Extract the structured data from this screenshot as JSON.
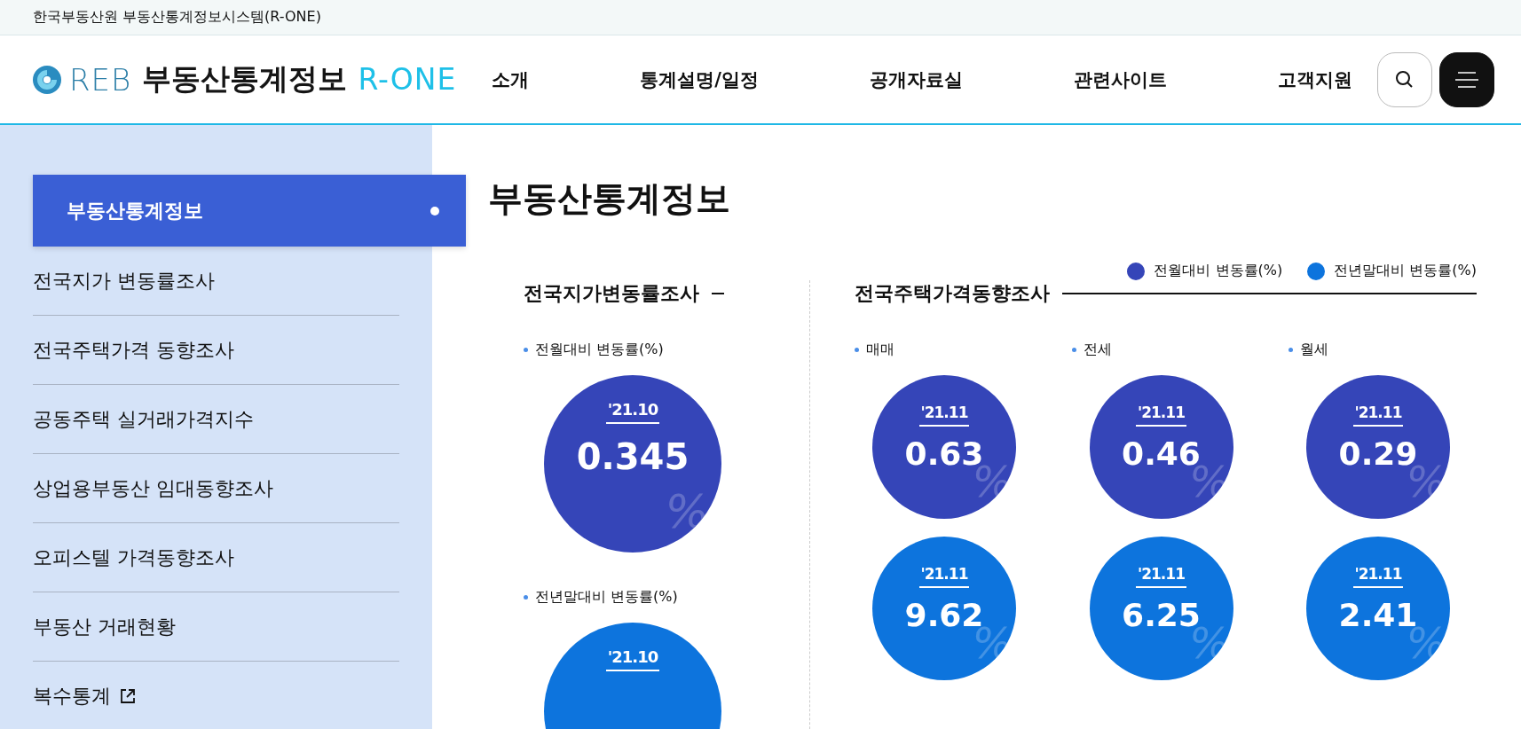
{
  "top_bar": {
    "text": "한국부동산원 부동산통계정보시스템(R-ONE)"
  },
  "header": {
    "logo": {
      "mark": "REB",
      "title": "부동산통계정보",
      "brand": "R-ONE"
    },
    "nav": [
      "소개",
      "통계설명/일정",
      "공개자료실",
      "관련사이트",
      "고객지원"
    ]
  },
  "sidebar": {
    "items": [
      {
        "label": "부동산통계정보",
        "selected": true,
        "external": false
      },
      {
        "label": "전국지가 변동률조사",
        "selected": false,
        "external": false
      },
      {
        "label": "전국주택가격 동향조사",
        "selected": false,
        "external": false
      },
      {
        "label": "공동주택 실거래가격지수",
        "selected": false,
        "external": false
      },
      {
        "label": "상업용부동산 임대동향조사",
        "selected": false,
        "external": false
      },
      {
        "label": "오피스텔 가격동향조사",
        "selected": false,
        "external": false
      },
      {
        "label": "부동산 거래현황",
        "selected": false,
        "external": false
      },
      {
        "label": "복수통계",
        "selected": false,
        "external": true
      }
    ]
  },
  "page_title": "부동산통계정보",
  "legend": [
    {
      "kind": "monthly",
      "label": "전월대비 변동률(%)",
      "color": "#3545b8"
    },
    {
      "kind": "yearly",
      "label": "전년말대비 변동률(%)",
      "color": "#0d74dd"
    }
  ],
  "land_survey": {
    "title": "전국지가변동률조사",
    "groups": [
      {
        "label": "전월대비 변동률(%)",
        "stat": {
          "kind": "monthly",
          "date": "'21.10",
          "value": "0.345",
          "unit": "%"
        }
      },
      {
        "label": "전년말대비 변동률(%)",
        "stat": {
          "kind": "yearly",
          "date": "'21.10"
        }
      }
    ]
  },
  "housing_survey": {
    "title": "전국주택가격동향조사",
    "columns": [
      {
        "label": "매매",
        "stats": [
          {
            "kind": "monthly",
            "date": "'21.11",
            "value": "0.63",
            "unit": "%"
          },
          {
            "kind": "yearly",
            "date": "'21.11",
            "value": "9.62",
            "unit": "%"
          }
        ]
      },
      {
        "label": "전세",
        "stats": [
          {
            "kind": "monthly",
            "date": "'21.11",
            "value": "0.46",
            "unit": "%"
          },
          {
            "kind": "yearly",
            "date": "'21.11",
            "value": "6.25",
            "unit": "%"
          }
        ]
      },
      {
        "label": "월세",
        "stats": [
          {
            "kind": "monthly",
            "date": "'21.11",
            "value": "0.29",
            "unit": "%"
          },
          {
            "kind": "yearly",
            "date": "'21.11",
            "value": "2.41",
            "unit": "%"
          }
        ]
      }
    ]
  }
}
